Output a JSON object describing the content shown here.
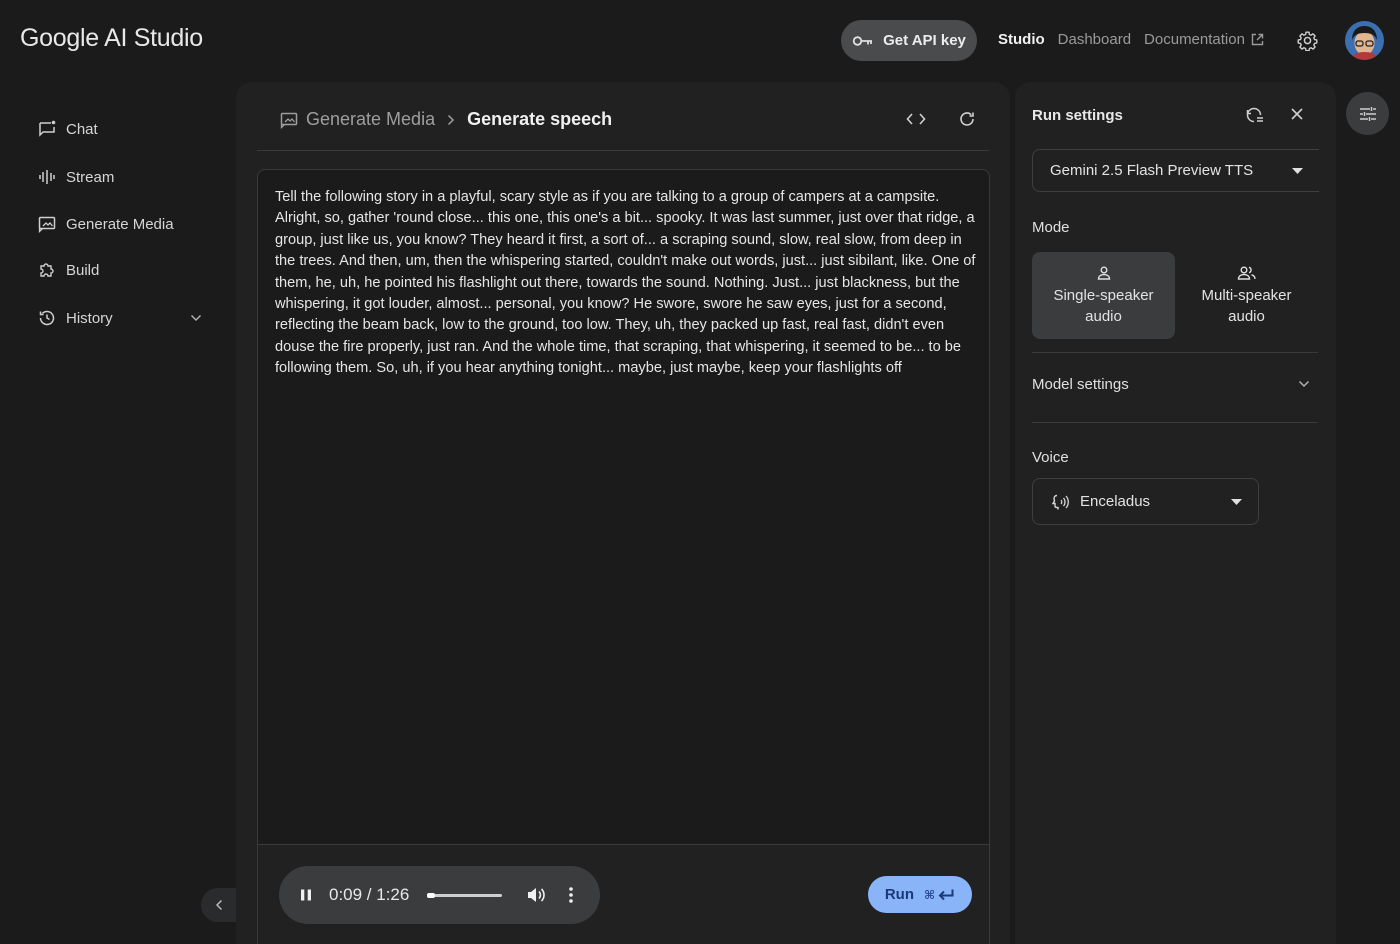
{
  "header": {
    "logo": "Google AI Studio",
    "api_key_label": "Get API key",
    "nav": [
      "Studio",
      "Dashboard",
      "Documentation"
    ]
  },
  "sidebar": {
    "items": [
      {
        "label": "Chat",
        "icon": "chat-icon"
      },
      {
        "label": "Stream",
        "icon": "waveform-icon"
      },
      {
        "label": "Generate Media",
        "icon": "image-icon"
      },
      {
        "label": "Build",
        "icon": "puzzle-icon"
      },
      {
        "label": "History",
        "icon": "history-icon"
      }
    ]
  },
  "main": {
    "breadcrumb_parent": "Generate Media",
    "breadcrumb_current": "Generate speech",
    "prompt": "Tell the following story in a playful, scary style as if you are talking to a group of campers at a campsite. Alright, so, gather 'round close... this one, this one's a bit... spooky. It was last summer, just over that ridge, a group, just like us, you know? They heard it first, a sort of... a scraping sound, slow, real slow, from deep in the trees. And then, um, then the whispering started, couldn't make out words, just... just sibilant, like. One of them, he, uh, he pointed his flashlight out there, towards the sound. Nothing. Just... just blackness, but the whispering, it got louder, almost... personal, you know? He swore, swore he saw eyes, just for a second, reflecting the beam back, low to the ground, too low. They, uh, they packed up fast, real fast, didn't even douse the fire properly, just ran. And the whole time, that scraping, that whispering, it seemed to be... to be following them. So, uh, if you hear anything tonight... maybe, just maybe, keep your flashlights off",
    "audio": {
      "time_display": "0:09 / 1:26",
      "progress": 0.1
    },
    "run_label": "Run",
    "run_shortcut": "⌘"
  },
  "settings": {
    "title": "Run settings",
    "model": "Gemini 2.5 Flash Preview TTS",
    "mode_label": "Mode",
    "modes": [
      "Single-speaker audio",
      "Multi-speaker audio"
    ],
    "model_settings_label": "Model settings",
    "voice_label": "Voice",
    "voice": "Enceladus"
  },
  "colors": {
    "background": "#1b1b1c",
    "panel": "#212122",
    "accent": "#8ab4f8"
  }
}
